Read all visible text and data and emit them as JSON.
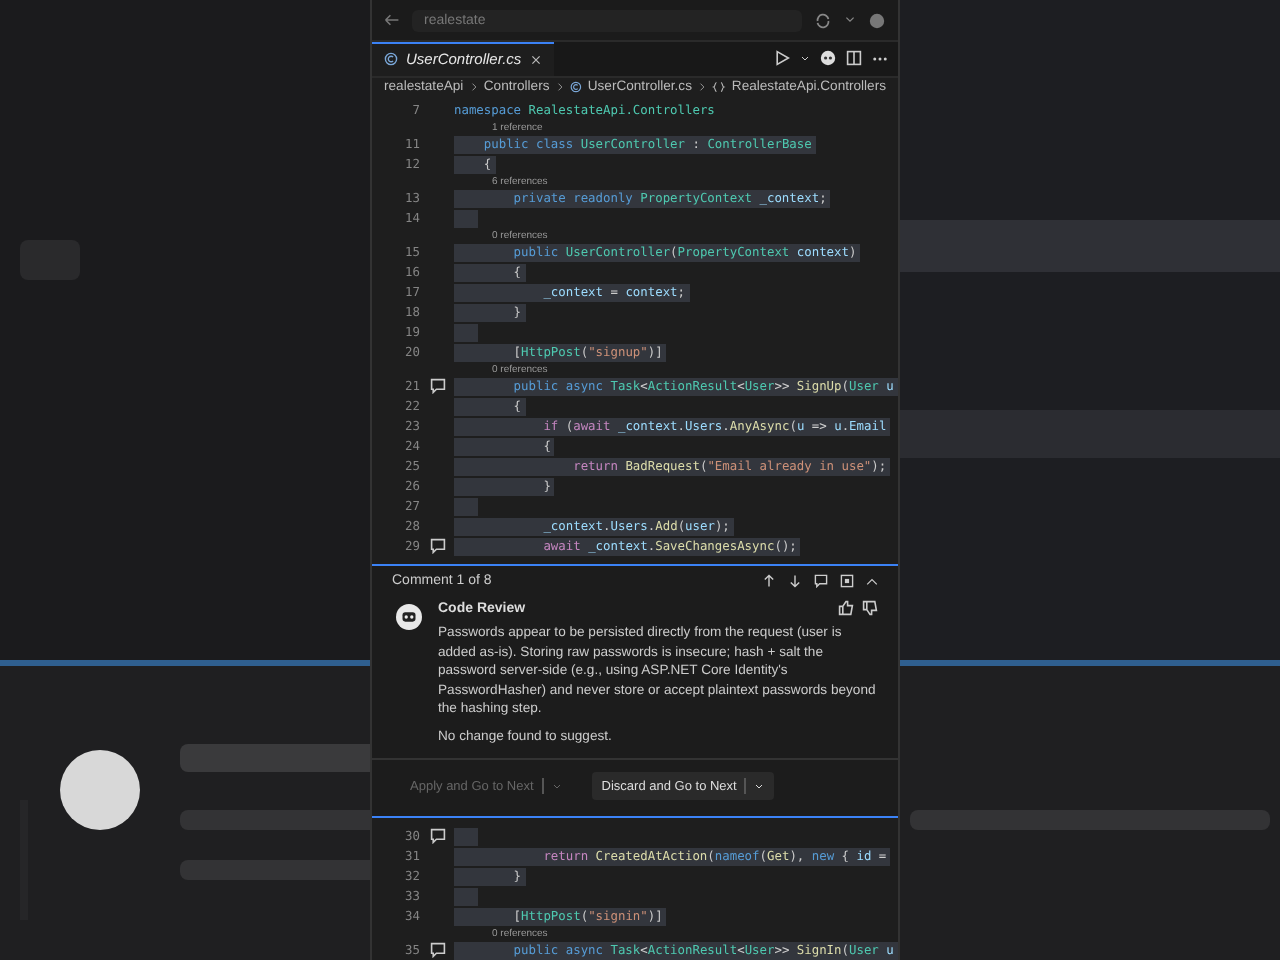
{
  "title_bar": {
    "title": "realestate"
  },
  "tab": {
    "label": "UserController.cs",
    "selected": true
  },
  "breadcrumb": [
    "realestateApi",
    "Controllers",
    "UserController.cs",
    "RealestateApi.Controllers"
  ],
  "code_top": [
    {
      "kind": "code",
      "number": "7",
      "selected": false,
      "comment": false,
      "tokens": [
        {
          "kind": "kw",
          "text": "namespace "
        },
        {
          "kind": "type",
          "text": "RealestateApi.Controllers"
        }
      ]
    },
    {
      "kind": "codelens",
      "text": "1 reference"
    },
    {
      "kind": "code",
      "number": "11",
      "selected": true,
      "comment": false,
      "tokens": [
        {
          "kind": "kw",
          "text": "    public class "
        },
        {
          "kind": "type",
          "text": "UserController"
        },
        {
          "kind": "plain",
          "text": " : "
        },
        {
          "kind": "type",
          "text": "ControllerBase"
        }
      ]
    },
    {
      "kind": "code",
      "number": "12",
      "selected": true,
      "comment": false,
      "tokens": [
        {
          "kind": "plain",
          "text": "    {"
        }
      ]
    },
    {
      "kind": "codelens",
      "text": "6 references"
    },
    {
      "kind": "code",
      "number": "13",
      "selected": true,
      "comment": false,
      "tokens": [
        {
          "kind": "kw",
          "text": "        private readonly "
        },
        {
          "kind": "type",
          "text": "PropertyContext"
        },
        {
          "kind": "var",
          "text": " _context"
        },
        {
          "kind": "plain",
          "text": ";"
        }
      ]
    },
    {
      "kind": "code",
      "number": "14",
      "selected": true,
      "comment": false
    },
    {
      "kind": "codelens",
      "text": "0 references"
    },
    {
      "kind": "code",
      "number": "15",
      "selected": true,
      "comment": false,
      "tokens": [
        {
          "kind": "kw",
          "text": "        public "
        },
        {
          "kind": "type",
          "text": "UserController"
        },
        {
          "kind": "plain",
          "text": "("
        },
        {
          "kind": "type",
          "text": "PropertyContext"
        },
        {
          "kind": "var",
          "text": " context"
        },
        {
          "kind": "plain",
          "text": ")"
        }
      ]
    },
    {
      "kind": "code",
      "number": "16",
      "selected": true,
      "comment": false,
      "tokens": [
        {
          "kind": "plain",
          "text": "        {"
        }
      ]
    },
    {
      "kind": "code",
      "number": "17",
      "selected": true,
      "comment": false,
      "tokens": [
        {
          "kind": "var",
          "text": "            _context"
        },
        {
          "kind": "plain",
          "text": " = "
        },
        {
          "kind": "var",
          "text": "context"
        },
        {
          "kind": "plain",
          "text": ";"
        }
      ]
    },
    {
      "kind": "code",
      "number": "18",
      "selected": true,
      "comment": false,
      "tokens": [
        {
          "kind": "plain",
          "text": "        }"
        }
      ]
    },
    {
      "kind": "code",
      "number": "19",
      "selected": true,
      "comment": false
    },
    {
      "kind": "code",
      "number": "20",
      "selected": true,
      "comment": false,
      "tokens": [
        {
          "kind": "plain",
          "text": "        ["
        },
        {
          "kind": "type",
          "text": "HttpPost"
        },
        {
          "kind": "plain",
          "text": "("
        },
        {
          "kind": "str",
          "text": "\"signup\""
        },
        {
          "kind": "plain",
          "text": ")]"
        }
      ]
    },
    {
      "kind": "codelens",
      "text": "0 references"
    },
    {
      "kind": "code",
      "number": "21",
      "selected": true,
      "comment": true,
      "tokens": [
        {
          "kind": "kw",
          "text": "        public async "
        },
        {
          "kind": "type",
          "text": "Task"
        },
        {
          "kind": "plain",
          "text": "<"
        },
        {
          "kind": "type",
          "text": "ActionResult"
        },
        {
          "kind": "plain",
          "text": "<"
        },
        {
          "kind": "type",
          "text": "User"
        },
        {
          "kind": "plain",
          "text": ">> "
        },
        {
          "kind": "fn",
          "text": "SignUp"
        },
        {
          "kind": "plain",
          "text": "("
        },
        {
          "kind": "type",
          "text": "User"
        },
        {
          "kind": "var",
          "text": " u"
        }
      ]
    },
    {
      "kind": "code",
      "number": "22",
      "selected": true,
      "comment": false,
      "tokens": [
        {
          "kind": "plain",
          "text": "        {"
        }
      ]
    },
    {
      "kind": "code",
      "number": "23",
      "selected": true,
      "comment": false,
      "tokens": [
        {
          "kind": "ctrl",
          "text": "            if"
        },
        {
          "kind": "plain",
          "text": " ("
        },
        {
          "kind": "ctrl",
          "text": "await"
        },
        {
          "kind": "var",
          "text": " _context"
        },
        {
          "kind": "plain",
          "text": "."
        },
        {
          "kind": "var",
          "text": "Users"
        },
        {
          "kind": "plain",
          "text": "."
        },
        {
          "kind": "fn",
          "text": "AnyAsync"
        },
        {
          "kind": "plain",
          "text": "("
        },
        {
          "kind": "var",
          "text": "u"
        },
        {
          "kind": "plain",
          "text": " => "
        },
        {
          "kind": "var",
          "text": "u"
        },
        {
          "kind": "plain",
          "text": "."
        },
        {
          "kind": "var",
          "text": "Email"
        }
      ]
    },
    {
      "kind": "code",
      "number": "24",
      "selected": true,
      "comment": false,
      "tokens": [
        {
          "kind": "plain",
          "text": "            {"
        }
      ]
    },
    {
      "kind": "code",
      "number": "25",
      "selected": true,
      "comment": false,
      "tokens": [
        {
          "kind": "ctrl",
          "text": "                return "
        },
        {
          "kind": "fn",
          "text": "BadRequest"
        },
        {
          "kind": "plain",
          "text": "("
        },
        {
          "kind": "str",
          "text": "\"Email already in use\""
        },
        {
          "kind": "plain",
          "text": ");"
        }
      ]
    },
    {
      "kind": "code",
      "number": "26",
      "selected": true,
      "comment": false,
      "tokens": [
        {
          "kind": "plain",
          "text": "            }"
        }
      ]
    },
    {
      "kind": "code",
      "number": "27",
      "selected": true,
      "comment": false
    },
    {
      "kind": "code",
      "number": "28",
      "selected": true,
      "comment": false,
      "tokens": [
        {
          "kind": "var",
          "text": "            _context"
        },
        {
          "kind": "plain",
          "text": "."
        },
        {
          "kind": "var",
          "text": "Users"
        },
        {
          "kind": "plain",
          "text": "."
        },
        {
          "kind": "fn",
          "text": "Add"
        },
        {
          "kind": "plain",
          "text": "("
        },
        {
          "kind": "var",
          "text": "user"
        },
        {
          "kind": "plain",
          "text": ");"
        }
      ]
    },
    {
      "kind": "code",
      "number": "29",
      "selected": true,
      "comment": true,
      "tokens": [
        {
          "kind": "ctrl",
          "text": "            await"
        },
        {
          "kind": "var",
          "text": " _context"
        },
        {
          "kind": "plain",
          "text": "."
        },
        {
          "kind": "fn",
          "text": "SaveChangesAsync"
        },
        {
          "kind": "plain",
          "text": "();"
        }
      ]
    }
  ],
  "comment_panel": {
    "counter": "Comment 1 of 8",
    "author": "Code Review",
    "message": "Passwords appear to be persisted directly from the request (user is added as-is). Storing raw passwords is insecure; hash + salt the password server-side (e.g., using ASP.NET Core Identity's PasswordHasher) and never store or accept plaintext passwords beyond the hashing step.",
    "note": "No change found to suggest.",
    "buttons": [
      {
        "label": "Apply and Go to Next",
        "disabled": true
      },
      {
        "label": "Discard and Go to Next",
        "disabled": false
      }
    ]
  },
  "code_bottom": [
    {
      "kind": "code",
      "number": "30",
      "selected": true,
      "comment": true
    },
    {
      "kind": "code",
      "number": "31",
      "selected": true,
      "comment": false,
      "tokens": [
        {
          "kind": "ctrl",
          "text": "            return "
        },
        {
          "kind": "fn",
          "text": "CreatedAtAction"
        },
        {
          "kind": "plain",
          "text": "("
        },
        {
          "kind": "kw",
          "text": "nameof"
        },
        {
          "kind": "plain",
          "text": "("
        },
        {
          "kind": "fn",
          "text": "Get"
        },
        {
          "kind": "plain",
          "text": "), "
        },
        {
          "kind": "kw",
          "text": "new"
        },
        {
          "kind": "plain",
          "text": " { "
        },
        {
          "kind": "var",
          "text": "id"
        },
        {
          "kind": "plain",
          "text": " ="
        }
      ]
    },
    {
      "kind": "code",
      "number": "32",
      "selected": true,
      "comment": false,
      "tokens": [
        {
          "kind": "plain",
          "text": "        }"
        }
      ]
    },
    {
      "kind": "code",
      "number": "33",
      "selected": true,
      "comment": false
    },
    {
      "kind": "code",
      "number": "34",
      "selected": true,
      "comment": false,
      "tokens": [
        {
          "kind": "plain",
          "text": "        ["
        },
        {
          "kind": "type",
          "text": "HttpPost"
        },
        {
          "kind": "plain",
          "text": "("
        },
        {
          "kind": "str",
          "text": "\"signin\""
        },
        {
          "kind": "plain",
          "text": ")]"
        }
      ]
    },
    {
      "kind": "codelens",
      "text": "0 references"
    },
    {
      "kind": "code",
      "number": "35",
      "selected": true,
      "comment": true,
      "tokens": [
        {
          "kind": "kw",
          "text": "        public async "
        },
        {
          "kind": "type",
          "text": "Task"
        },
        {
          "kind": "plain",
          "text": "<"
        },
        {
          "kind": "type",
          "text": "ActionResult"
        },
        {
          "kind": "plain",
          "text": "<"
        },
        {
          "kind": "type",
          "text": "User"
        },
        {
          "kind": "plain",
          "text": ">> "
        },
        {
          "kind": "fn",
          "text": "SignIn"
        },
        {
          "kind": "plain",
          "text": "("
        },
        {
          "kind": "type",
          "text": "User"
        },
        {
          "kind": "var",
          "text": " u"
        }
      ]
    }
  ]
}
